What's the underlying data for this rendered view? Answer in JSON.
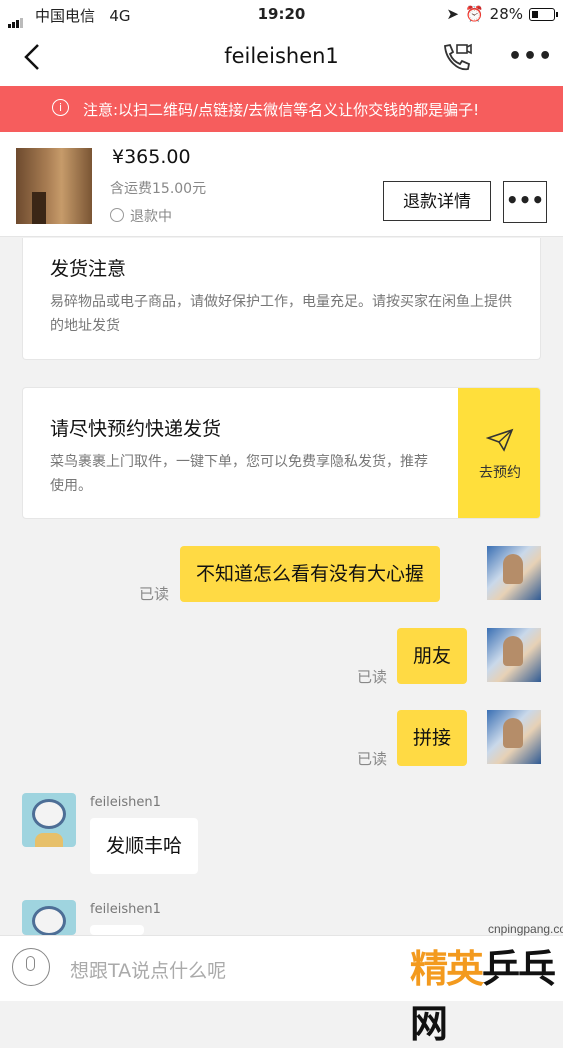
{
  "status_bar": {
    "carrier": "中国电信",
    "network": "4G",
    "time": "19:20",
    "battery": "28%"
  },
  "nav": {
    "title": "feileishen1",
    "back_icon": "chevron-left-icon",
    "call_icon": "phone-video-icon",
    "more_icon": "more-dots-icon"
  },
  "warning": {
    "text": "注意:以扫二维码/点链接/去微信等名义让你交钱的都是骗子!"
  },
  "product": {
    "price": "¥365.00",
    "shipping": "含运费15.00元",
    "status": "退款中",
    "refund_button": "退款详情",
    "more_button": "•••"
  },
  "shipping_notice": {
    "title": "发货注意",
    "body": "易碎物品或电子商品，请做好保护工作，电量充足。请按买家在闲鱼上提供的地址发货"
  },
  "courier_card": {
    "title": "请尽快预约快递发货",
    "body": "菜鸟裹裹上门取件，一键下单，您可以免费享隐私发货，推荐使用。",
    "action": "去预约"
  },
  "messages": [
    {
      "from": "me",
      "text": "不知道怎么看有没有大心握",
      "read": "已读"
    },
    {
      "from": "me",
      "text": "朋友",
      "read": "已读"
    },
    {
      "from": "me",
      "text": "拼接",
      "read": "已读"
    },
    {
      "from": "them",
      "user": "feileishen1",
      "text": "发顺丰哈"
    },
    {
      "from": "them",
      "user": "feileishen1",
      "text": ""
    }
  ],
  "input": {
    "placeholder": "想跟TA说点什么呢"
  },
  "watermark": {
    "site": "cnpingpang.com",
    "logo_left": "精英",
    "logo_right": "乒乓网"
  },
  "colors": {
    "warning_bg": "#f65d5d",
    "my_bubble": "#ffda44",
    "courier_accent": "#ffdf3b"
  }
}
